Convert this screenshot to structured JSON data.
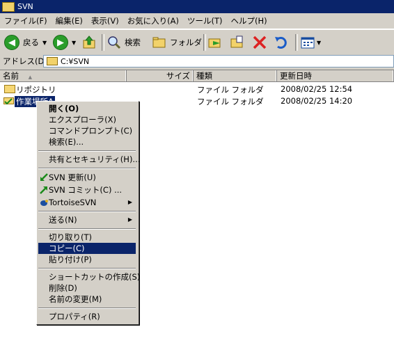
{
  "window": {
    "title": "SVN"
  },
  "menu": [
    "ファイル(F)",
    "編集(E)",
    "表示(V)",
    "お気に入り(A)",
    "ツール(T)",
    "ヘルプ(H)"
  ],
  "toolbar": {
    "back_label": "戻る",
    "search_label": "検索",
    "folders_label": "フォルダ"
  },
  "address": {
    "label": "アドレス(D)",
    "value": "C:¥SVN"
  },
  "columns": [
    "名前",
    "サイズ",
    "種類",
    "更新日時"
  ],
  "files": [
    {
      "name": "リポジトリ",
      "type": "ファイル フォルダ",
      "modified": "2008/02/25 12:54"
    },
    {
      "name": "作業場所A",
      "type": "ファイル フォルダ",
      "modified": "2008/02/25 14:20"
    }
  ],
  "context_menu": {
    "open": "開く(O)",
    "explorer": "エクスプローラ(X)",
    "cmd": "コマンドプロンプト(C)",
    "search": "検索(E)...",
    "share": "共有とセキュリティ(H)...",
    "svn_update": "SVN 更新(U)",
    "svn_commit": "SVN コミット(C) ...",
    "tortoise": "TortoiseSVN",
    "send_to": "送る(N)",
    "cut": "切り取り(T)",
    "copy": "コピー(C)",
    "paste": "貼り付け(P)",
    "shortcut": "ショートカットの作成(S)",
    "delete": "削除(D)",
    "rename": "名前の変更(M)",
    "properties": "プロパティ(R)"
  },
  "colors": {
    "titlebar": "#0a246a",
    "selection": "#0a246a",
    "chrome": "#d4d0c8"
  }
}
